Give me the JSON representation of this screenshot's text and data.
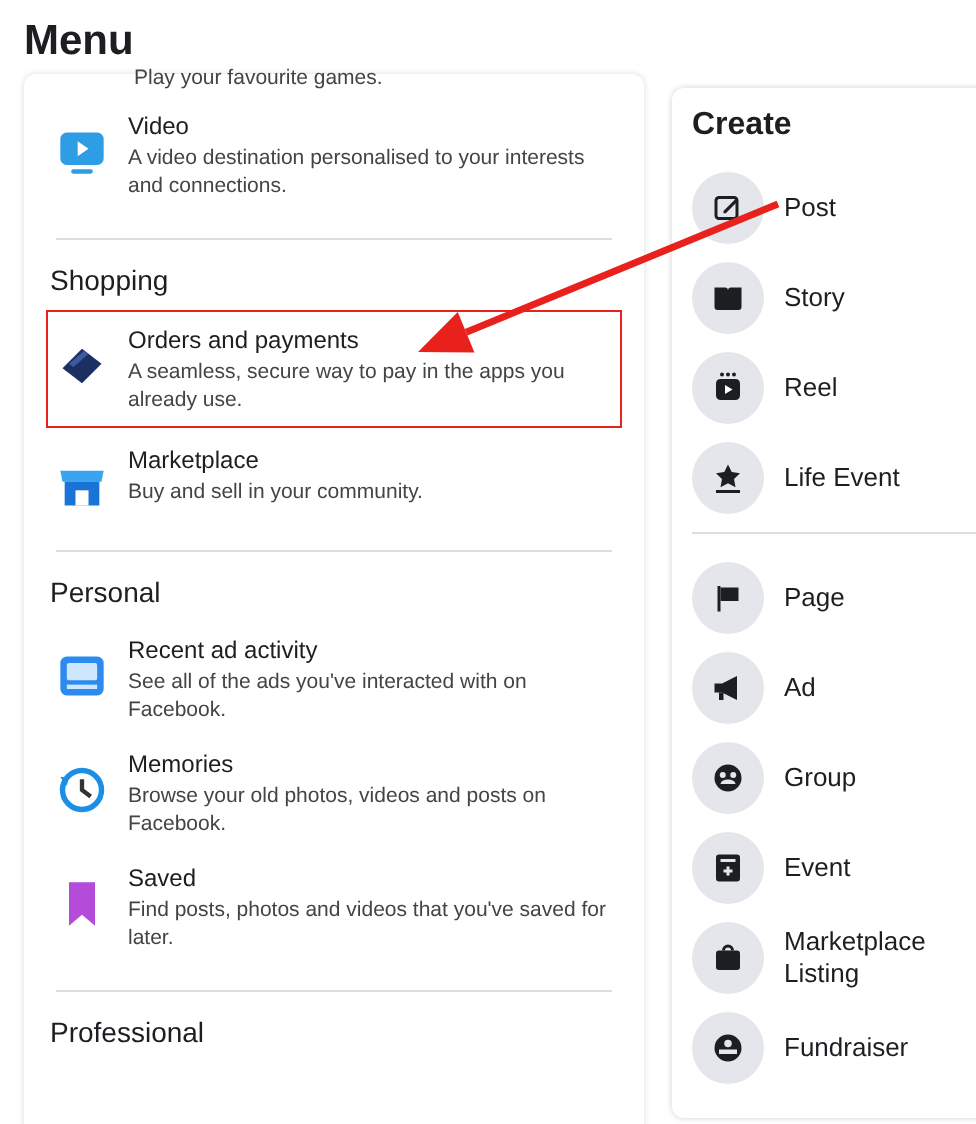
{
  "title": "Menu",
  "menu_sections": [
    {
      "items": [
        {
          "description": "Play your favourite games.",
          "highlighted": false
        },
        {
          "title": "Video",
          "description": "A video destination personalised to your interests and connections.",
          "highlighted": false
        }
      ]
    },
    {
      "heading": "Shopping",
      "items": [
        {
          "title": "Orders and payments",
          "description": "A seamless, secure way to pay in the apps you already use.",
          "highlighted": true
        },
        {
          "title": "Marketplace",
          "description": "Buy and sell in your community.",
          "highlighted": false
        }
      ]
    },
    {
      "heading": "Personal",
      "items": [
        {
          "title": "Recent ad activity",
          "description": "See all of the ads you've interacted with on Facebook.",
          "highlighted": false
        },
        {
          "title": "Memories",
          "description": "Browse your old photos, videos and posts on Facebook.",
          "highlighted": false
        },
        {
          "title": "Saved",
          "description": "Find posts, photos and videos that you've saved for later.",
          "highlighted": false
        }
      ]
    },
    {
      "heading": "Professional"
    }
  ],
  "create": {
    "title": "Create",
    "groups": [
      [
        {
          "label": "Post"
        },
        {
          "label": "Story"
        },
        {
          "label": "Reel"
        },
        {
          "label": "Life Event"
        }
      ],
      [
        {
          "label": "Page"
        },
        {
          "label": "Ad"
        },
        {
          "label": "Group"
        },
        {
          "label": "Event"
        },
        {
          "label": "Marketplace Listing"
        },
        {
          "label": "Fundraiser"
        }
      ]
    ]
  }
}
